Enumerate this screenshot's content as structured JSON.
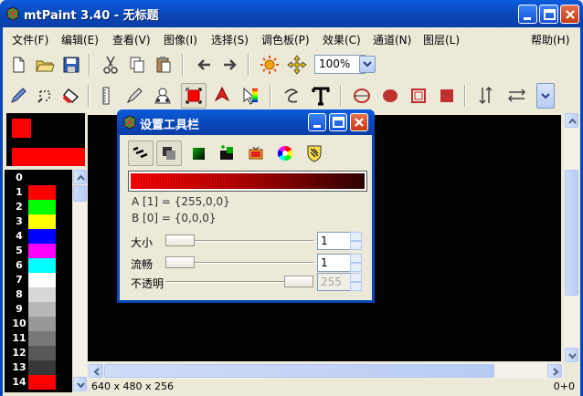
{
  "window": {
    "title": "mtPaint 3.40 - 无标题",
    "icon": "mtpaint-app-icon"
  },
  "menu": [
    "文件(F)",
    "编辑(E)",
    "查看(V)",
    "图像(I)",
    "选择(S)",
    "调色板(P)",
    "效果(C)",
    "通道(N)",
    "图层(L)",
    "帮助(H)"
  ],
  "toolbar": {
    "zoom_value": "100%",
    "icons_row1": [
      "new-file-icon",
      "open-folder-icon",
      "save-disk-icon",
      "cut-icon",
      "copy-icon",
      "paste-icon",
      "undo-arrow-icon",
      "redo-arrow-icon",
      "pan-sun-icon",
      "move-crosshair-icon"
    ],
    "icons_row2": [
      "pencil-icon",
      "paint-brush-icon",
      "flood-fill-icon",
      "line-ruler-icon",
      "smudge-icon",
      "clone-icon",
      "select-rect-icon",
      "select-lasso-icon",
      "polygon-icon",
      "curve-icon",
      "text-icon",
      "ellipse-outline-icon",
      "ellipse-fill-icon",
      "rect-outline-icon",
      "rect-fill-icon",
      "flip-vertical-icon",
      "flip-horizontal-icon",
      "dropdown-icon"
    ]
  },
  "palette": {
    "indices": [
      "0",
      "1",
      "2",
      "3",
      "4",
      "5",
      "6",
      "7",
      "8",
      "9",
      "10",
      "11",
      "12",
      "13",
      "14"
    ],
    "colors": [
      "#000000",
      "#ff0000",
      "#00ff00",
      "#ffff00",
      "#0000ff",
      "#ff00ff",
      "#00ffff",
      "#ffffff",
      "#d8d8d8",
      "#b8b8b8",
      "#989898",
      "#787878",
      "#585858",
      "#383838",
      "#ff0000"
    ]
  },
  "status": {
    "geometry": "640 x 480 x 256",
    "coords": "0+0"
  },
  "dialog": {
    "title": "设置工具栏",
    "color_a": "A [1] = {255,0,0}",
    "color_b": "B [0] = {0,0,0}",
    "size_label": "大小",
    "size_value": "1",
    "flow_label": "流畅",
    "flow_value": "1",
    "opacity_label": "不透明",
    "opacity_value": "255",
    "tool_icons": [
      "continuous-mode-icon",
      "opacity-mode-icon",
      "gradient-mode-icon",
      "pattern-mode-icon",
      "brush-mode-icon",
      "color-wheel-icon",
      "shield-pattern-icon"
    ]
  },
  "colors": {
    "accent": "#0846b5",
    "primary": "#ff0000",
    "secondary": "#000000"
  }
}
